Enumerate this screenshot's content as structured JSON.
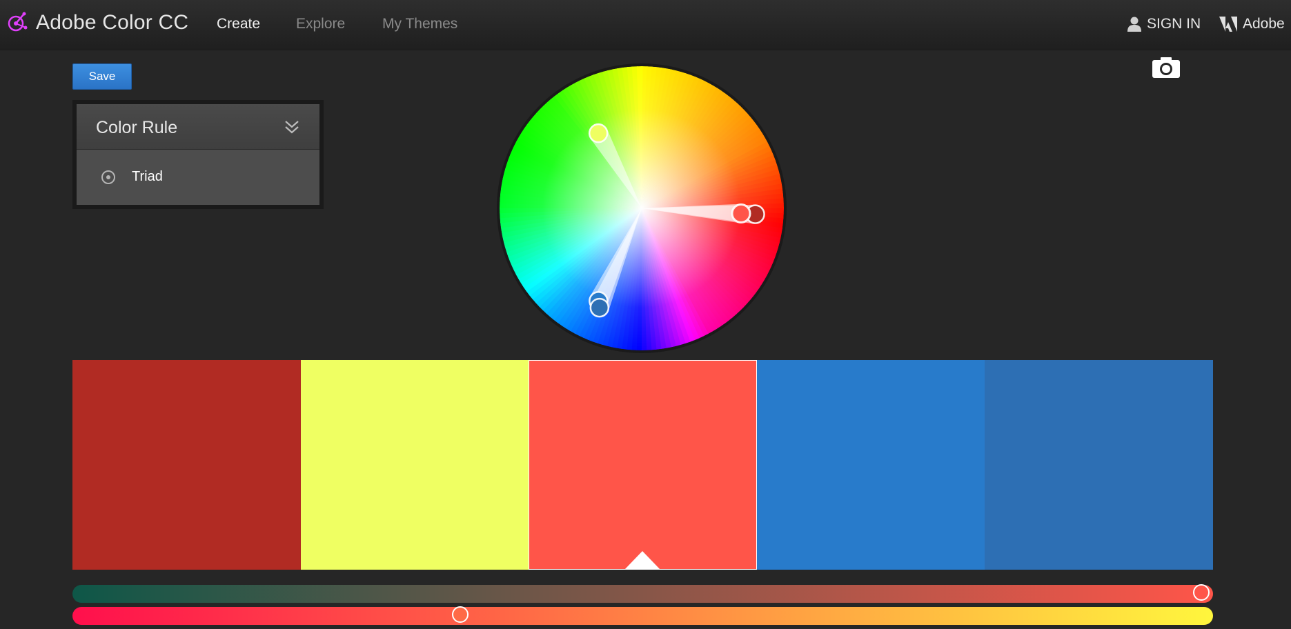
{
  "app": {
    "title": "Adobe Color CC"
  },
  "nav": {
    "items": [
      {
        "label": "Create",
        "active": true
      },
      {
        "label": "Explore",
        "active": false
      },
      {
        "label": "My Themes",
        "active": false
      }
    ],
    "sign_in": "SIGN IN",
    "brand": "Adobe"
  },
  "toolbar": {
    "save_label": "Save"
  },
  "color_rule": {
    "title": "Color Rule",
    "selected_option": "Triad"
  },
  "icons": {
    "logo": "adobe-color-logo-icon",
    "user": "user-icon",
    "adobe": "adobe-logo-icon",
    "chevron": "double-chevron-down-icon",
    "radio": "radio-icon",
    "camera": "camera-icon"
  },
  "swatches": [
    {
      "color": "#B12B23",
      "selected": false
    },
    {
      "color": "#EFFF62",
      "selected": false
    },
    {
      "color": "#FF5549",
      "selected": true
    },
    {
      "color": "#287BCB",
      "selected": false
    },
    {
      "color": "#2D6FB4",
      "selected": false
    }
  ],
  "sliders": [
    {
      "gradient_start": "#0e5748",
      "gradient_end": "#ff5549",
      "value": 0.99
    },
    {
      "gradient_start": "#ff0f4c",
      "gradient_end": "#fff63d",
      "value": 0.34
    }
  ],
  "wheel": {
    "handles": [
      {
        "hue": 58,
        "distance": 0.61,
        "color": "#EFFF62",
        "base": false
      },
      {
        "hue": 4,
        "distance": 0.8,
        "color": "#B12B23",
        "base": false
      },
      {
        "hue": 4,
        "distance": 0.7,
        "color": "#FF5549",
        "base": true
      },
      {
        "hue": 212,
        "distance": 0.72,
        "color": "#287BCB",
        "base": false
      },
      {
        "hue": 213,
        "distance": 0.76,
        "color": "#2D6FB4",
        "base": false
      }
    ]
  }
}
